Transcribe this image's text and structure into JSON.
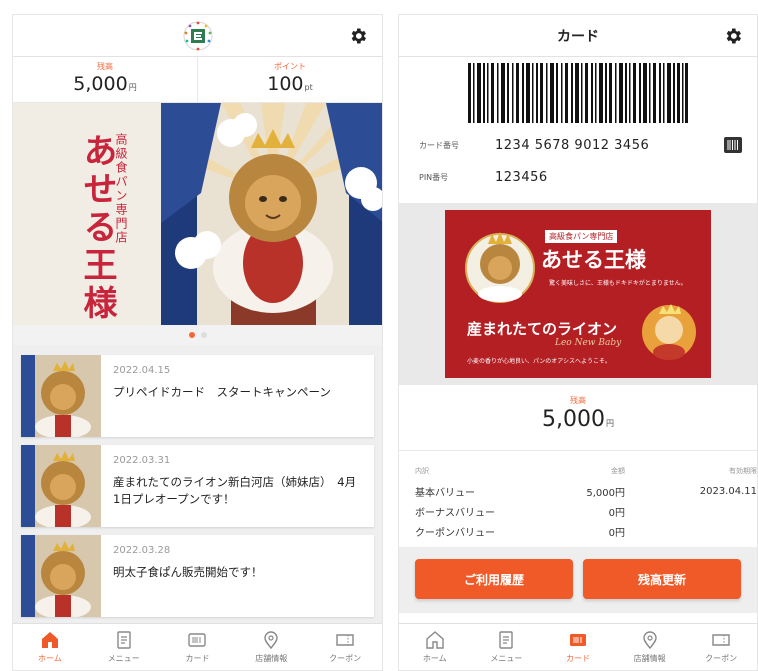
{
  "home": {
    "balance_label": "残高",
    "balance_value": "5,000",
    "balance_unit": "円",
    "points_label": "ポイント",
    "points_value": "100",
    "points_unit": "pt",
    "hero_title": "あせる王様",
    "hero_subtitle": "高級食パン専門店",
    "news": [
      {
        "date": "2022.04.15",
        "text": "プリペイドカード　スタートキャンペーン"
      },
      {
        "date": "2022.03.31",
        "text": "産まれたてのライオン新白河店（姉妹店）　4月1日プレオープンです！"
      },
      {
        "date": "2022.03.28",
        "text": "明太子食ぱん販売開始です！"
      }
    ]
  },
  "card": {
    "header_title": "カード",
    "card_number_label": "カード番号",
    "card_number": "1234 5678 9012 3456",
    "pin_label": "PIN番号",
    "pin": "123456",
    "banner": {
      "tag": "高級食パン専門店",
      "title": "あせる王様",
      "desc": "驚く美味しさに、王様もドキドキがとまりません。",
      "headline": "産まれたてのライオン",
      "english": "Leo New Baby",
      "footer": "小麦の香りが心地良い、パンのオアシスへようこそ。"
    },
    "balance_label": "残高",
    "balance_value": "5,000",
    "balance_unit": "円",
    "table_head": [
      "内訳",
      "金額",
      "有効期限"
    ],
    "rows": [
      {
        "name": "基本バリュー",
        "amount": "5,000円",
        "expiry": "2023.04.11"
      },
      {
        "name": "ボーナスバリュー",
        "amount": "0円",
        "expiry": ""
      },
      {
        "name": "クーポンバリュー",
        "amount": "0円",
        "expiry": ""
      }
    ],
    "history_button": "ご利用履歴",
    "refresh_button": "残高更新"
  },
  "tabs": [
    {
      "label": "ホーム",
      "icon": "home-icon"
    },
    {
      "label": "メニュー",
      "icon": "menu-doc-icon"
    },
    {
      "label": "カード",
      "icon": "card-icon"
    },
    {
      "label": "店舗情報",
      "icon": "location-icon"
    },
    {
      "label": "クーポン",
      "icon": "coupon-icon"
    }
  ],
  "colors": {
    "accent": "#f5663a",
    "brand_red": "#b41f24",
    "title_red": "#c8243b"
  }
}
